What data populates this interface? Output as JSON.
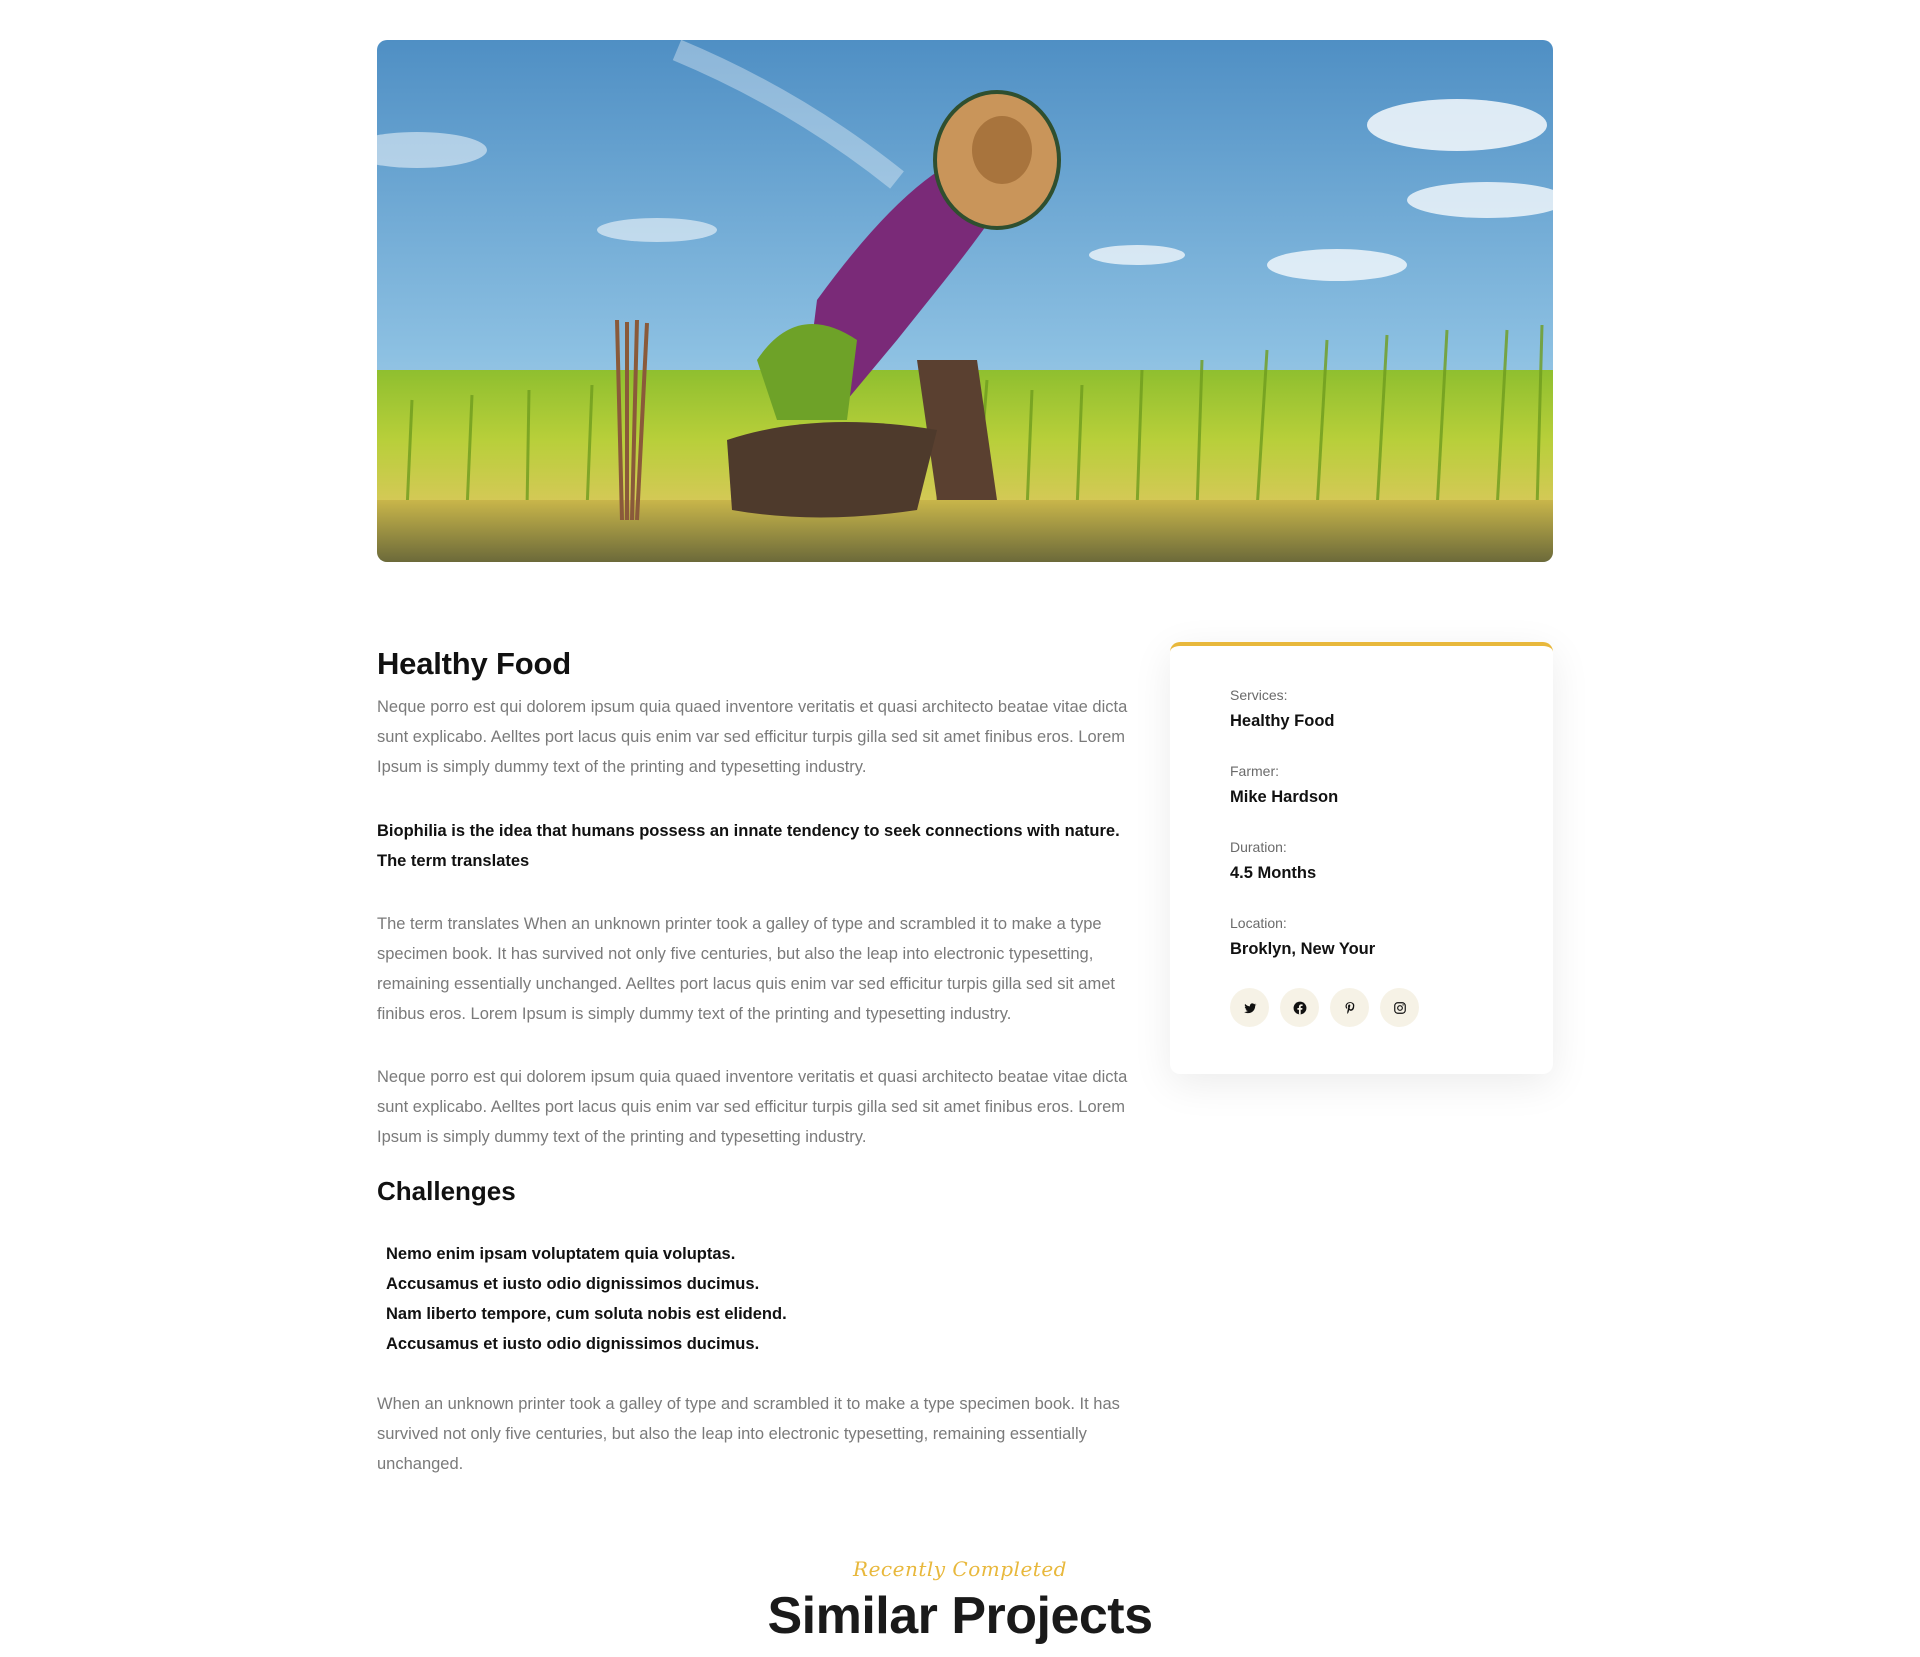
{
  "hero": {
    "alt_icon": "farmer-rice-field-image"
  },
  "article": {
    "title": "Healthy Food",
    "intro": "Neque porro est qui dolorem ipsum quia quaed inventore veritatis et quasi architecto beatae vitae dicta sunt explicabo. Aelltes port lacus quis enim var sed efficitur turpis gilla sed sit amet finibus eros. Lorem Ipsum is simply dummy text of the printing and typesetting industry.",
    "highlight": "Biophilia is the idea that humans possess an innate tendency to seek connections with nature. The term translates",
    "body1": "The term translates When an unknown printer took a galley of type and scrambled it to make a type specimen book. It has survived not only five centuries, but also the leap into electronic typesetting, remaining essentially unchanged. Aelltes port lacus quis enim var sed efficitur turpis gilla sed sit amet finibus eros. Lorem Ipsum is simply dummy text of the printing and typesetting industry.",
    "body2": "Neque porro est qui dolorem ipsum quia quaed inventore veritatis et quasi architecto beatae vitae dicta sunt explicabo. Aelltes port lacus quis enim var sed efficitur turpis gilla sed sit amet finibus eros. Lorem Ipsum is simply dummy text of the printing and typesetting industry.",
    "challenges_title": "Challenges",
    "challenges": [
      "Nemo enim ipsam voluptatem quia voluptas.",
      "Accusamus et iusto odio dignissimos ducimus.",
      "Nam liberto tempore, cum soluta nobis est elidend.",
      "Accusamus et iusto odio dignissimos ducimus."
    ],
    "closing": "When an unknown printer took a galley of type and scrambled it to make a type specimen book. It has survived not only five centuries, but also the leap into electronic typesetting, remaining essentially unchanged."
  },
  "sidebar": {
    "accent_color": "#e8b83c",
    "items": [
      {
        "label": "Services:",
        "value": "Healthy Food"
      },
      {
        "label": "Farmer:",
        "value": "Mike Hardson"
      },
      {
        "label": "Duration:",
        "value": "4.5 Months"
      },
      {
        "label": "Location:",
        "value": "Broklyn, New Your"
      }
    ],
    "socials": [
      "twitter-icon",
      "facebook-icon",
      "pinterest-icon",
      "instagram-icon"
    ]
  },
  "section": {
    "eyebrow": "Recently Completed",
    "title": "Similar Projects"
  }
}
